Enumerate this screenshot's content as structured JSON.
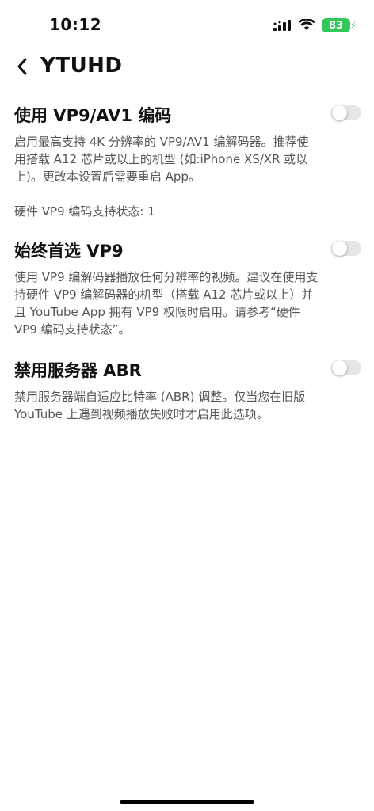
{
  "status_bar": {
    "time": "10:12",
    "battery_level": "83",
    "signal_icon": "cellular-signal-icon",
    "wifi_icon": "wifi-icon",
    "battery_color": "#34c759"
  },
  "nav": {
    "back_icon": "chevron-left-icon",
    "title": "YTUHD"
  },
  "settings": [
    {
      "title": "使用 VP9/AV1 编码",
      "enabled": false,
      "description": "启用最高支持 4K 分辨率的 VP9/AV1 编解码器。推荐使用搭载 A12 芯片或以上的机型 (如:iPhone XS/XR 或以上)。更改本设置后需要重启 App。",
      "status": "硬件 VP9 编码支持状态: 1"
    },
    {
      "title": "始终首选 VP9",
      "enabled": false,
      "description": "使用 VP9 编解码器播放任何分辨率的视频。建议在使用支持硬件 VP9 编解码器的机型（搭载 A12 芯片或以上）并且 YouTube App 拥有 VP9 权限时启用。请参考“硬件 VP9 编码支持状态”。"
    },
    {
      "title": "禁用服务器 ABR",
      "enabled": false,
      "description": "禁用服务器端自适应比特率 (ABR) 调整。仅当您在旧版 YouTube 上遇到视频播放失败时才启用此选项。"
    }
  ],
  "colors": {
    "toggle_off": "#e5e5ea",
    "secondary_text": "#555555"
  }
}
